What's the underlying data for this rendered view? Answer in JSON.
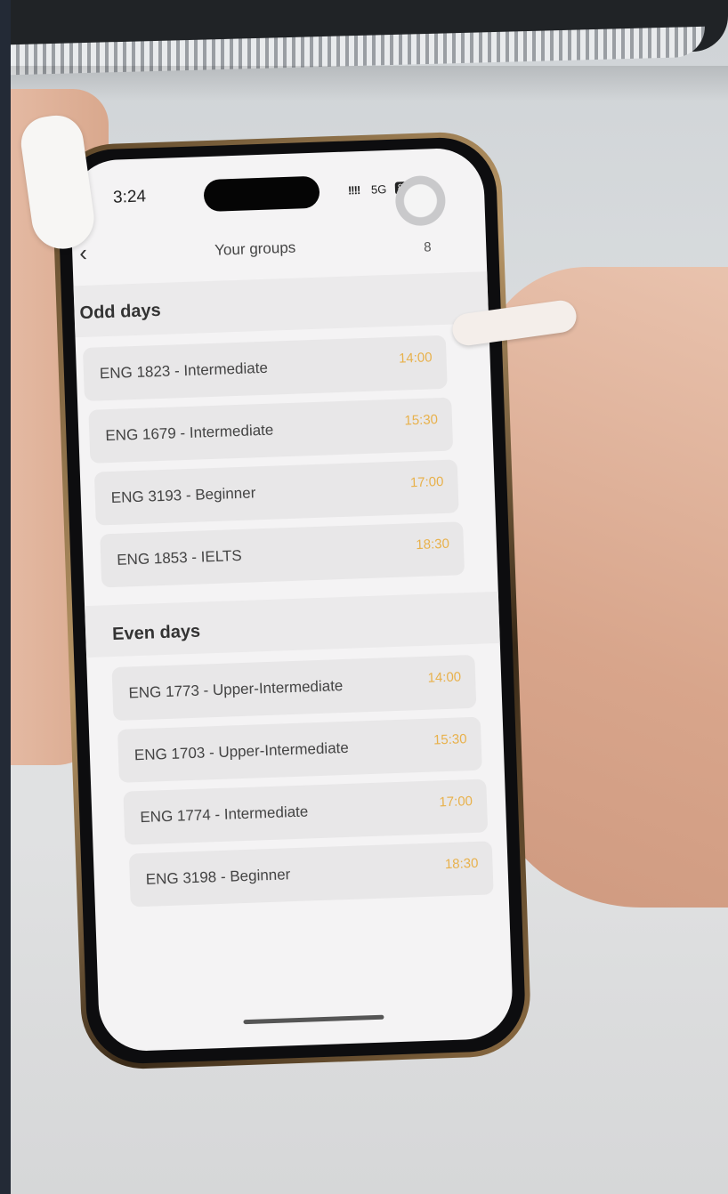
{
  "status": {
    "time": "3:24",
    "signal": "!!!!",
    "network": "5G",
    "battery": "86"
  },
  "header": {
    "back_icon": "chevron-left-icon",
    "title": "Your groups",
    "count": "8"
  },
  "sections": [
    {
      "title": "Odd days",
      "groups": [
        {
          "name": "ENG 1823 - Intermediate",
          "time": "14:00"
        },
        {
          "name": "ENG 1679 - Intermediate",
          "time": "15:30"
        },
        {
          "name": "ENG 3193 - Beginner",
          "time": "17:00"
        },
        {
          "name": "ENG 1853 - IELTS",
          "time": "18:30"
        }
      ]
    },
    {
      "title": "Even days",
      "groups": [
        {
          "name": "ENG 1773 - Upper-Intermediate",
          "time": "14:00"
        },
        {
          "name": "ENG 1703 - Upper-Intermediate",
          "time": "15:30"
        },
        {
          "name": "ENG 1774 - Intermediate",
          "time": "17:00"
        },
        {
          "name": "ENG 3198 - Beginner",
          "time": "18:30"
        }
      ]
    }
  ],
  "colors": {
    "time_accent": "#e8b14b",
    "screen_bg": "#f4f3f4",
    "row_bg": "#e8e7e8"
  }
}
